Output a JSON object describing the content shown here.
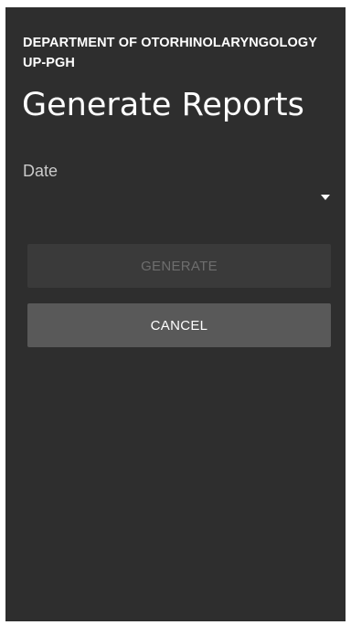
{
  "header": {
    "department_line1": "DEPARTMENT OF OTORHINOLARYNGOLOGY",
    "department_line2": "UP-PGH",
    "title": "Generate Reports"
  },
  "form": {
    "date_label": "Date",
    "date_value": "",
    "dropdown_icon": "caret-down-icon"
  },
  "actions": {
    "generate_label": "GENERATE",
    "generate_enabled": false,
    "cancel_label": "CANCEL"
  },
  "colors": {
    "background": "#2e2e2e",
    "button_disabled": "#3a3a3a",
    "button_enabled": "#595959",
    "text_primary": "#ffffff",
    "text_secondary": "#c9c9c9",
    "text_disabled": "#6e6e6e"
  }
}
